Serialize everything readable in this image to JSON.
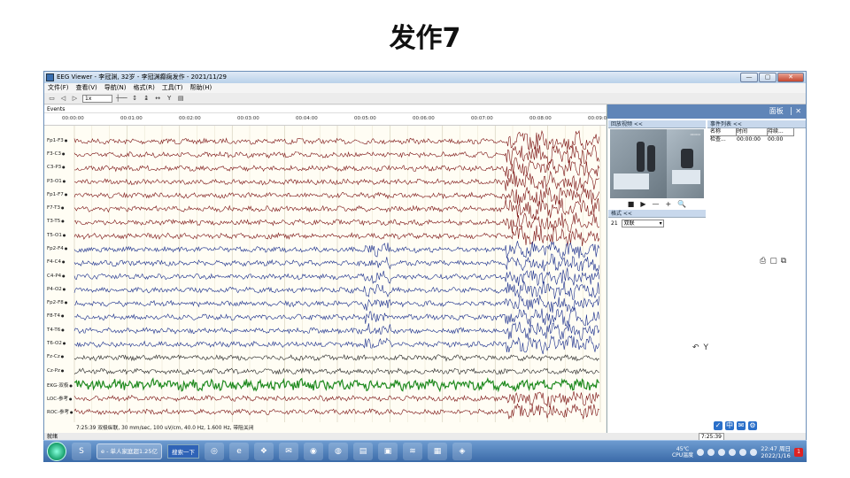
{
  "slide": {
    "title": "发作7"
  },
  "window": {
    "title": "EEG Viewer - 李冠渊, 32岁 - 李冠渊癫痫发作 - 2021/11/29",
    "buttons": {
      "minimize": "—",
      "maximize": "▢",
      "close": "✕"
    }
  },
  "menu": [
    "文件(F)",
    "查看(V)",
    "导航(N)",
    "格式(R)",
    "工具(T)",
    "帮助(H)"
  ],
  "toolbar": {
    "speed": "1x"
  },
  "events_label": "Events",
  "timeline": [
    "00:00:00",
    "00:01:00",
    "00:02:00",
    "00:03:00",
    "00:04:00",
    "00:05:00",
    "00:06:00",
    "00:07:00",
    "00:08:00",
    "00:09:0"
  ],
  "channels": [
    "Fp1-F3",
    "F3-C3",
    "C3-P3",
    "P3-O1",
    "Fp1-F7",
    "F7-T3",
    "T3-T5",
    "T5-O1",
    "Fp2-F4",
    "F4-C4",
    "C4-P4",
    "P4-O2",
    "Fp2-F8",
    "F8-T4",
    "T4-T6",
    "T6-O2",
    "Fz-Cz",
    "Cz-Pz",
    "EKG-双极",
    "LOC-参考",
    "ROC-参考"
  ],
  "colors": {
    "left": "#7a1010",
    "right": "#152a8a",
    "midline": "#222222",
    "ekg": "#1f8a1f",
    "ref": "#7a1010"
  },
  "montage_info": "7:25:39 双极纵联, 30 mm/sec, 100 uV/cm, 40.0 Hz, 1.600 Hz, 带阻关闭",
  "status": {
    "text": "就绪",
    "time": "7:25:39"
  },
  "panel": {
    "header": "面板",
    "close": "✕",
    "video": {
      "title": "回放视频 <<",
      "controls": [
        "■",
        "▶",
        "—",
        "+",
        "🔍"
      ]
    },
    "events": {
      "title": "事件列表 <<",
      "columns": [
        "名称",
        "时间",
        "持续..."
      ],
      "rows": [
        [
          "检查...",
          "00:00:00",
          "00:00"
        ]
      ]
    },
    "format": {
      "title": "格式 <<",
      "number": "21",
      "value": "双联"
    }
  },
  "taskbar": {
    "task": "单人家庭超1.25亿",
    "search": "搜索一下",
    "temp": "45℃",
    "temp_label": "CPU温度",
    "time": "22:47 周日",
    "date": "2022/1/16",
    "badge": "1"
  }
}
